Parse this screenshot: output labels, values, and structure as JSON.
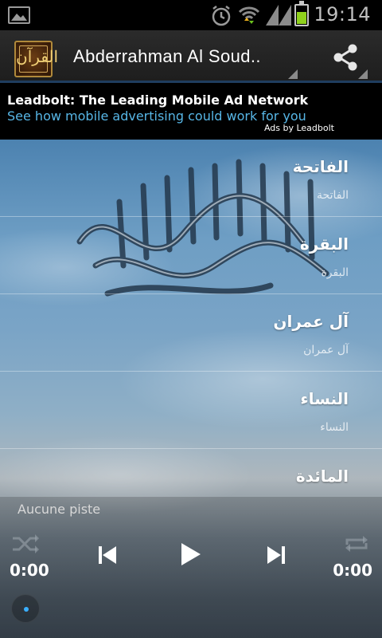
{
  "status_bar": {
    "time": "19:14",
    "battery_level": 0.7,
    "icons": [
      "gallery-icon",
      "alarm-icon",
      "wifi-icon",
      "signal-icon",
      "battery-icon"
    ]
  },
  "action_bar": {
    "title": "Abderrahman Al Soud..",
    "app_icon_glyph": "القرآن",
    "actions": [
      "share-icon"
    ]
  },
  "ad": {
    "headline": "Leadbolt: The Leading Mobile Ad Network",
    "subtext": "See how mobile advertising could work for you",
    "by": "Ads by Leadbolt"
  },
  "surahs": [
    {
      "name": "الفاتحة",
      "subtitle": "الفاتحة"
    },
    {
      "name": "البقرة",
      "subtitle": "البقرة"
    },
    {
      "name": "آل عمران",
      "subtitle": "آل عمران"
    },
    {
      "name": "النساء",
      "subtitle": "النساء"
    },
    {
      "name": "المائدة",
      "subtitle": ""
    }
  ],
  "player": {
    "track": "Aucune piste",
    "elapsed": "0:00",
    "duration": "0:00",
    "controls": [
      "shuffle-icon",
      "previous-icon",
      "play-icon",
      "next-icon",
      "repeat-icon"
    ]
  },
  "colors": {
    "accent_blue": "#57b6e6",
    "battery_green": "#8fd11c",
    "action_bar_underline": "#1f3d5e"
  }
}
